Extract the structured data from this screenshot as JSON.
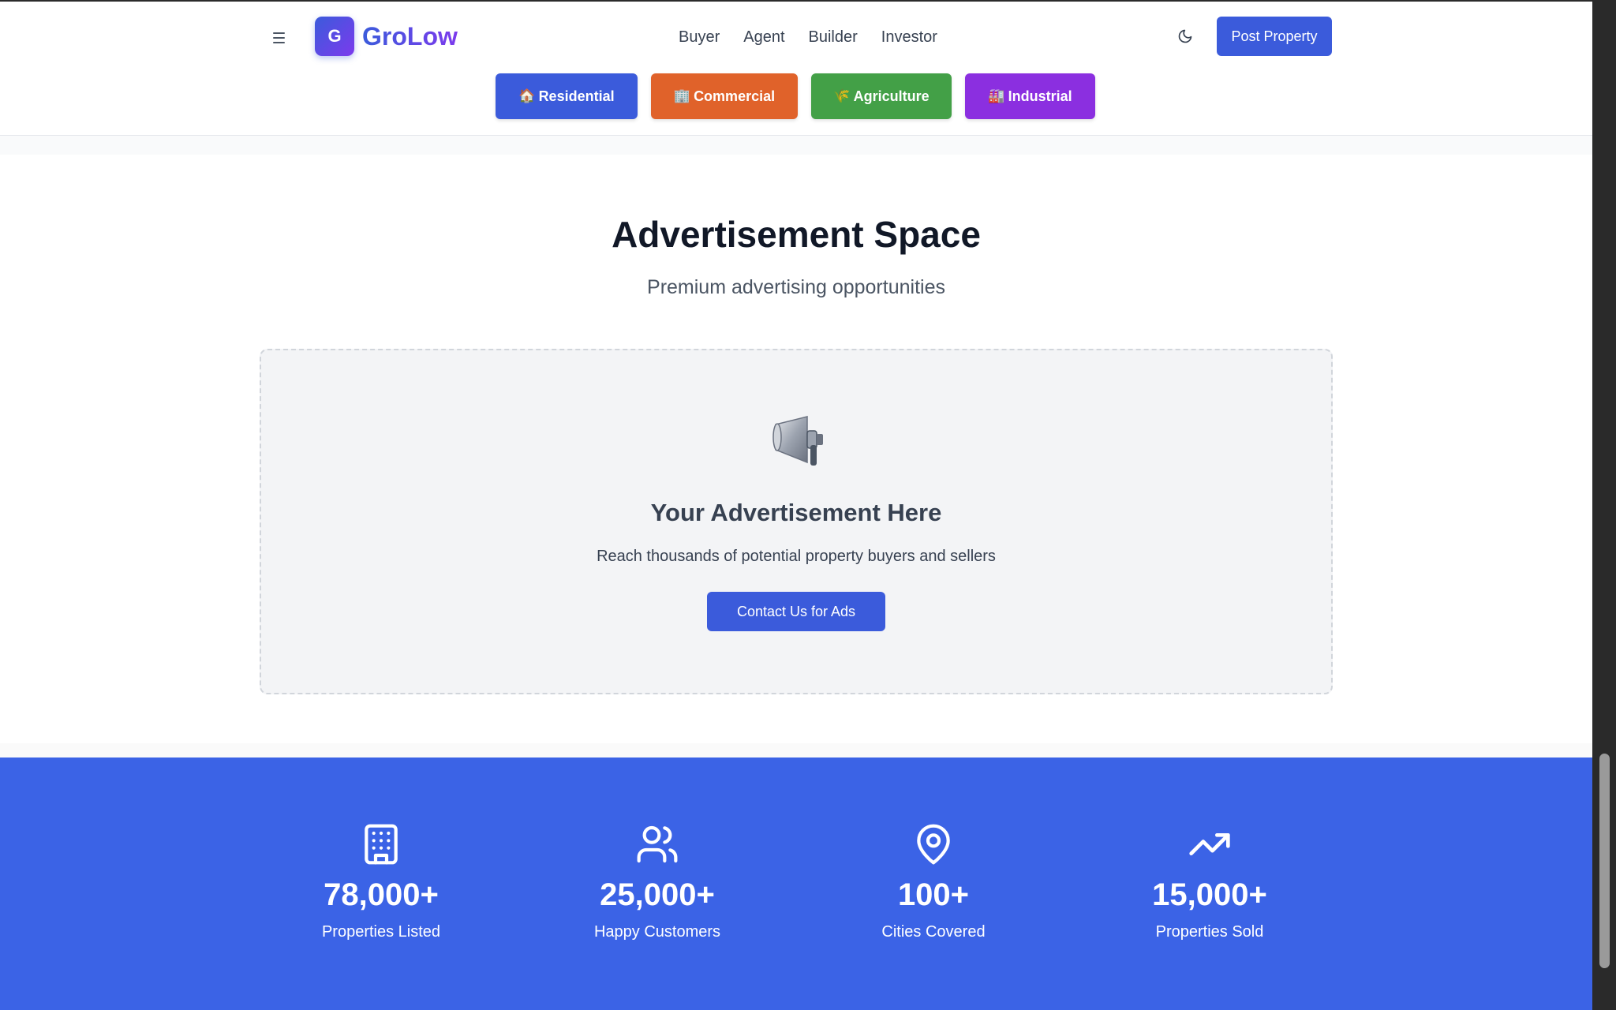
{
  "header": {
    "logo_letter": "G",
    "brand": "GroLow",
    "nav": [
      "Buyer",
      "Agent",
      "Builder",
      "Investor"
    ],
    "post_button": "Post Property",
    "menu_icon": "hamburger-icon",
    "theme_icon": "moon-icon"
  },
  "categories": [
    {
      "icon": "🏠",
      "label": "Residential",
      "color": "#3b5bdb"
    },
    {
      "icon": "🏢",
      "label": "Commercial",
      "color": "#e0622a"
    },
    {
      "icon": "🌾",
      "label": "Agriculture",
      "color": "#43a047"
    },
    {
      "icon": "🏭",
      "label": "Industrial",
      "color": "#8b2fe0"
    }
  ],
  "ad": {
    "title": "Advertisement Space",
    "subtitle": "Premium advertising opportunities",
    "icon": "megaphone-icon",
    "box_title": "Your Advertisement Here",
    "box_desc": "Reach thousands of potential property buyers and sellers",
    "cta": "Contact Us for Ads"
  },
  "stats": [
    {
      "icon": "building-icon",
      "value": "78,000+",
      "label": "Properties Listed"
    },
    {
      "icon": "users-icon",
      "value": "25,000+",
      "label": "Happy Customers"
    },
    {
      "icon": "map-pin-icon",
      "value": "100+",
      "label": "Cities Covered"
    },
    {
      "icon": "trending-up-icon",
      "value": "15,000+",
      "label": "Properties Sold"
    }
  ],
  "colors": {
    "primary": "#3b5bdb",
    "stats_bg": "#3b63e6",
    "brand_gradient_end": "#7c3aed"
  }
}
